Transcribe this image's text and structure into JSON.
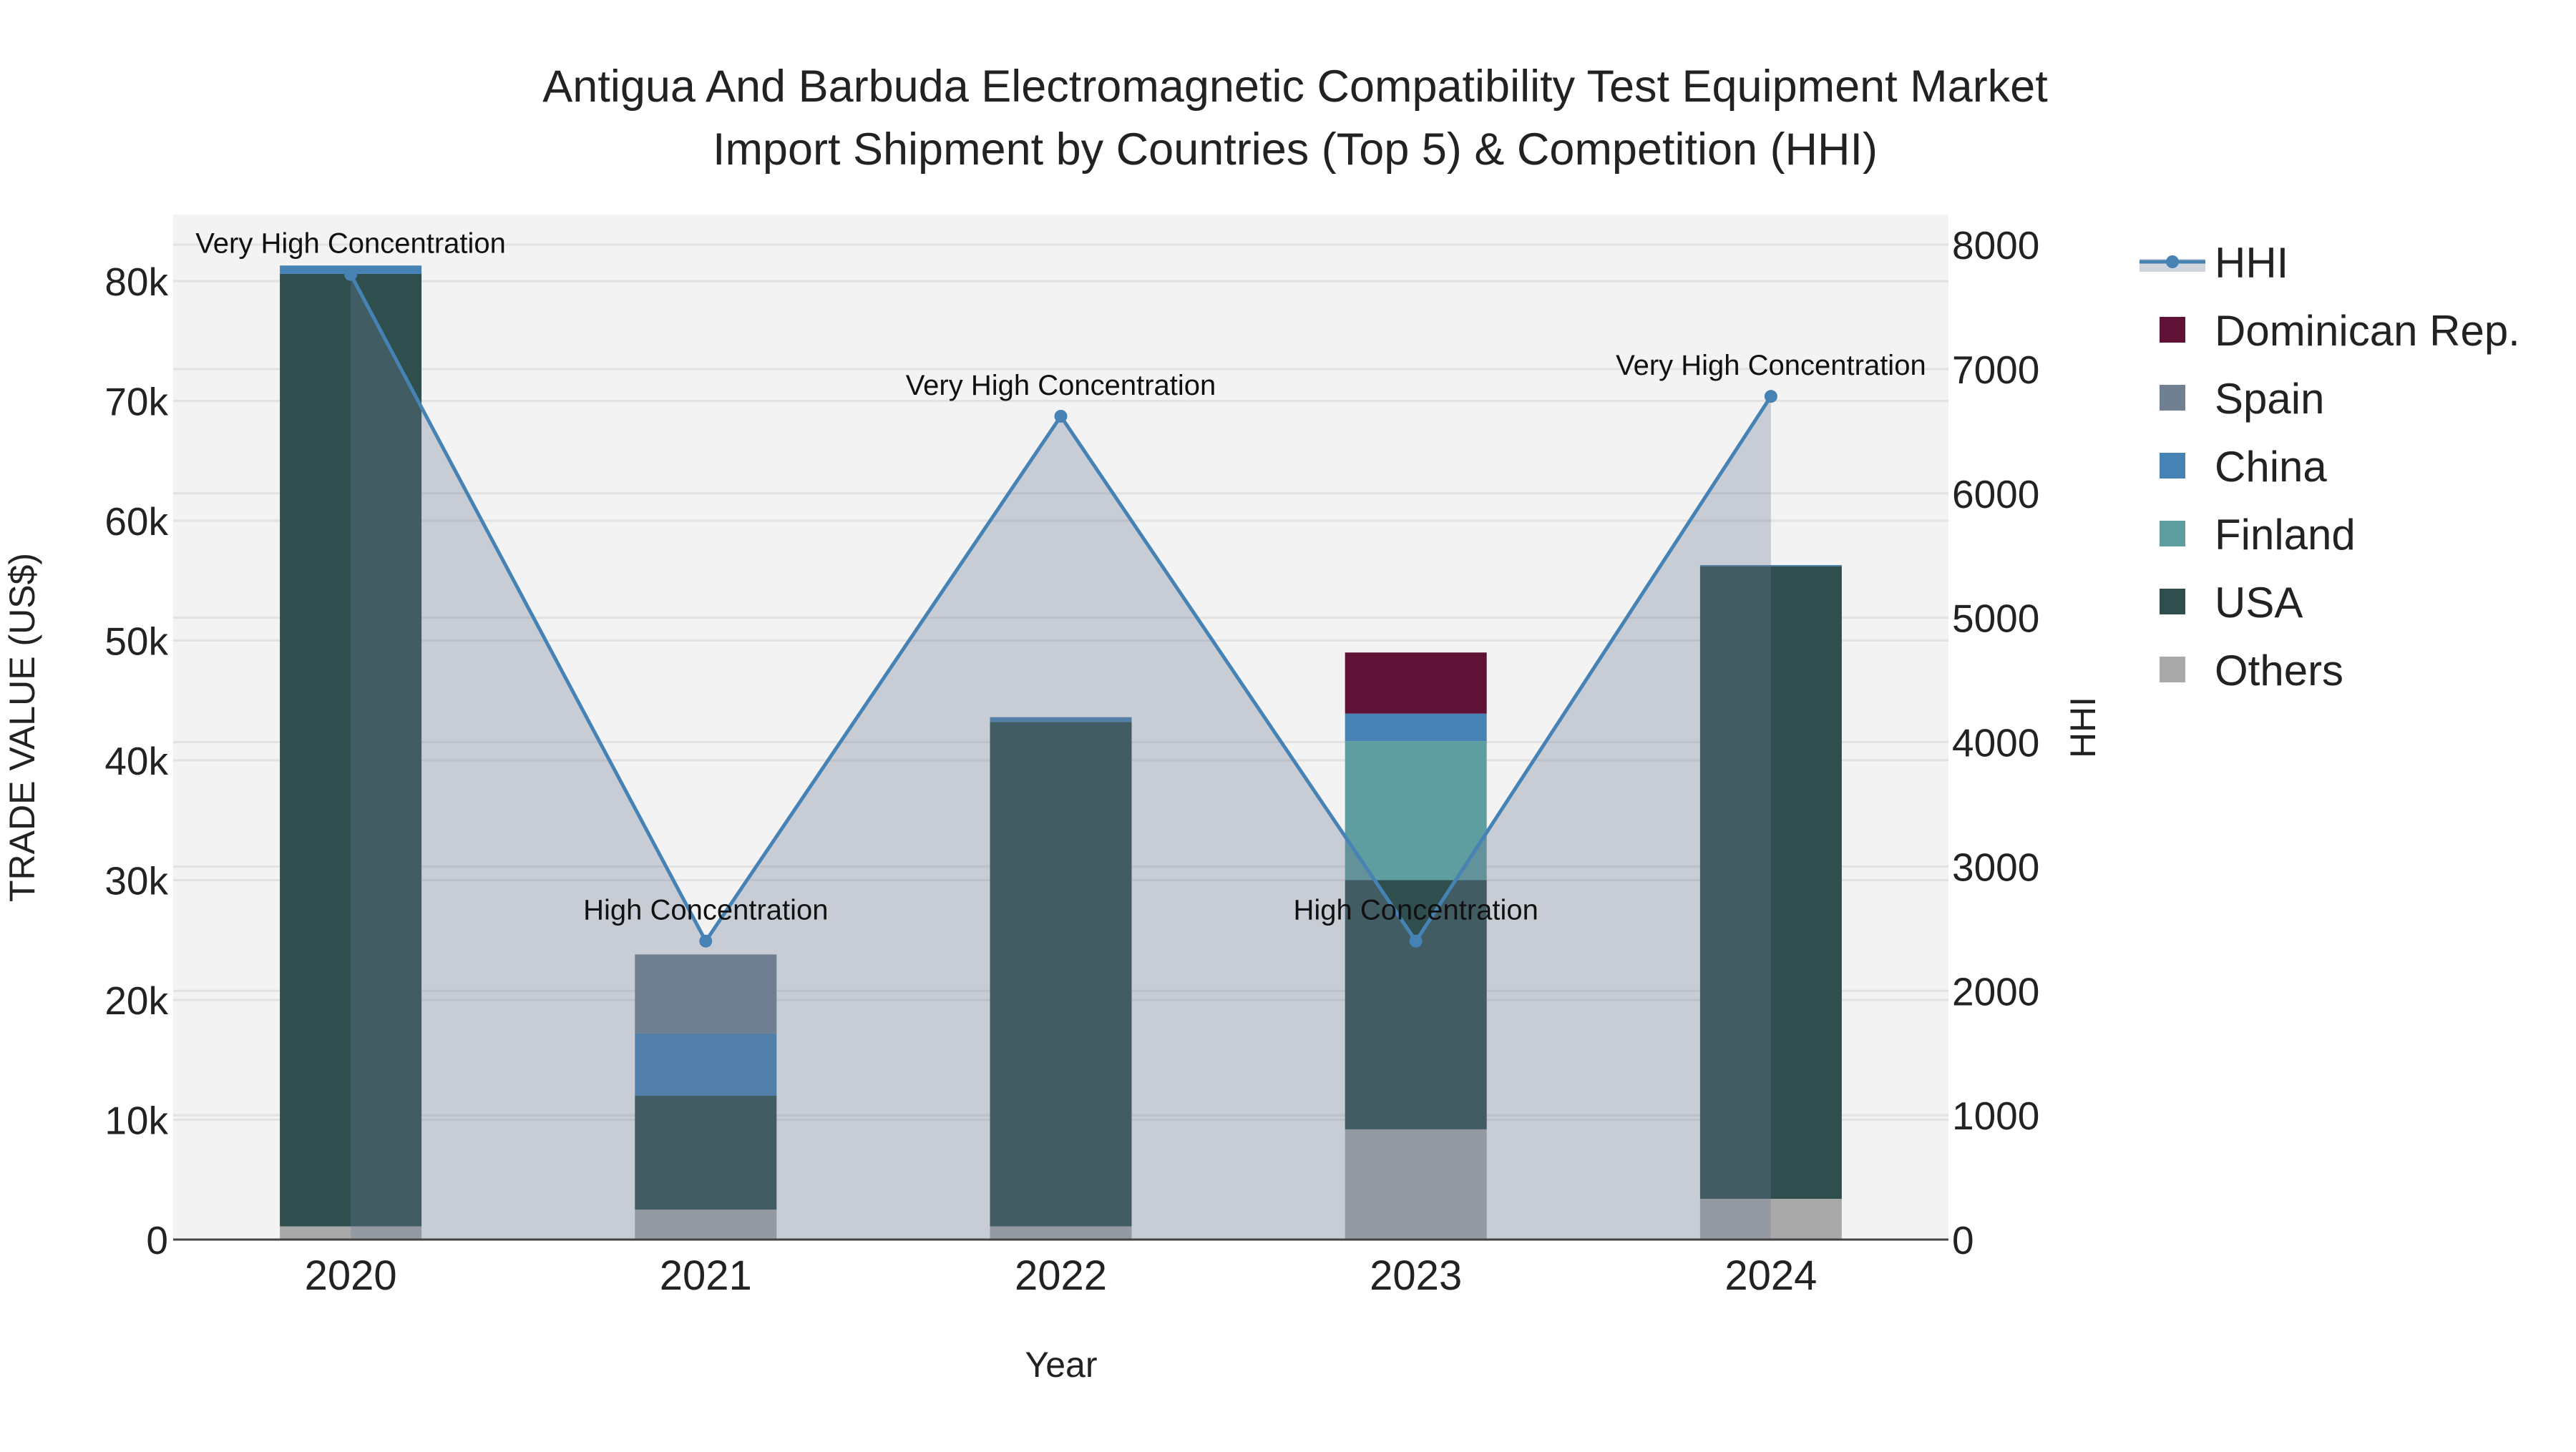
{
  "chart_data": {
    "type": "bar",
    "title_line1": "Antigua And Barbuda Electromagnetic Compatibility Test Equipment Market",
    "title_line2": "Import Shipment by Countries (Top 5) & Competition (HHI)",
    "xlabel": "Year",
    "ylabel": "TRADE VALUE (US$)",
    "y2label": "HHI",
    "categories": [
      "2020",
      "2021",
      "2022",
      "2023",
      "2024"
    ],
    "ylim": [
      0,
      85000
    ],
    "y2lim": [
      0,
      8235
    ],
    "yticks": [
      0,
      10000,
      20000,
      30000,
      40000,
      50000,
      60000,
      70000,
      80000
    ],
    "ytick_labels": [
      "0",
      "10k",
      "20k",
      "30k",
      "40k",
      "50k",
      "60k",
      "70k",
      "80k"
    ],
    "y2ticks": [
      0,
      1000,
      2000,
      3000,
      4000,
      5000,
      6000,
      7000,
      8000
    ],
    "y2tick_labels": [
      "0",
      "1000",
      "2000",
      "3000",
      "4000",
      "5000",
      "6000",
      "7000",
      "8000"
    ],
    "grid": true,
    "legend_position": "right",
    "series": [
      {
        "name": "Others",
        "color": "#A9A9A9",
        "values": [
          1100,
          2500,
          1100,
          9200,
          3400
        ]
      },
      {
        "name": "USA",
        "color": "#2F4F4F",
        "values": [
          79500,
          9500,
          42100,
          20800,
          52800
        ]
      },
      {
        "name": "Finland",
        "color": "#5F9EA0",
        "values": [
          0,
          0,
          0,
          11600,
          0
        ]
      },
      {
        "name": "China",
        "color": "#4682B4",
        "values": [
          700,
          5200,
          400,
          2300,
          100
        ]
      },
      {
        "name": "Spain",
        "color": "#708090",
        "values": [
          0,
          6600,
          0,
          0,
          0
        ]
      },
      {
        "name": "Dominican Rep.",
        "color": "#601236",
        "values": [
          0,
          0,
          0,
          5100,
          0
        ]
      }
    ],
    "hhi": {
      "name": "HHI",
      "color": "#4682B4",
      "values": [
        7760,
        2400,
        6620,
        2400,
        6780
      ],
      "annotations": [
        "Very High Concentration",
        "High Concentration",
        "Very High Concentration",
        "High Concentration",
        "Very High Concentration"
      ]
    },
    "legend_order": [
      "HHI",
      "Dominican Rep.",
      "Spain",
      "China",
      "Finland",
      "USA",
      "Others"
    ]
  }
}
